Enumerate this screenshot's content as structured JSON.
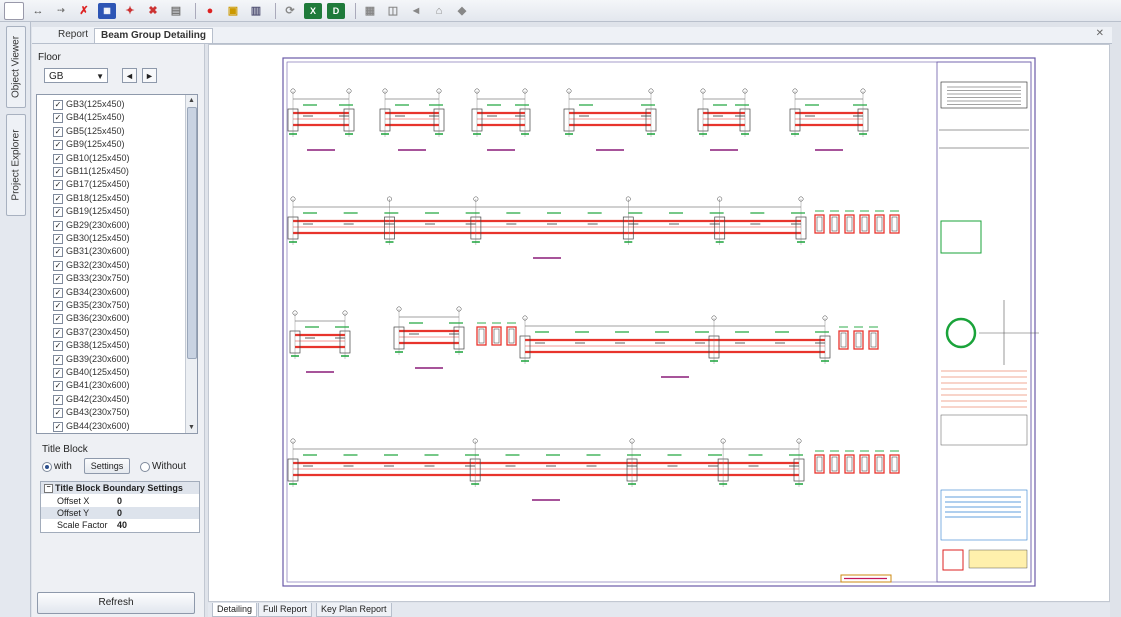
{
  "side_tabs": [
    "Object Viewer",
    "Project Explorer"
  ],
  "doc_tabs": [
    "Report",
    "Beam Group Detailing"
  ],
  "floor": {
    "label": "Floor",
    "value": "GB",
    "nav_prev": "◄",
    "nav_next": "►"
  },
  "beams": [
    {
      "name": "GB3(125x450)",
      "checked": true
    },
    {
      "name": "GB4(125x450)",
      "checked": true
    },
    {
      "name": "GB5(125x450)",
      "checked": true
    },
    {
      "name": "GB9(125x450)",
      "checked": true
    },
    {
      "name": "GB10(125x450)",
      "checked": true
    },
    {
      "name": "GB11(125x450)",
      "checked": true
    },
    {
      "name": "GB17(125x450)",
      "checked": true
    },
    {
      "name": "GB18(125x450)",
      "checked": true
    },
    {
      "name": "GB19(125x450)",
      "checked": true
    },
    {
      "name": "GB29(230x600)",
      "checked": true
    },
    {
      "name": "GB30(125x450)",
      "checked": true
    },
    {
      "name": "GB31(230x600)",
      "checked": true
    },
    {
      "name": "GB32(230x450)",
      "checked": true
    },
    {
      "name": "GB33(230x750)",
      "checked": true
    },
    {
      "name": "GB34(230x600)",
      "checked": true
    },
    {
      "name": "GB35(230x750)",
      "checked": true
    },
    {
      "name": "GB36(230x600)",
      "checked": true
    },
    {
      "name": "GB37(230x450)",
      "checked": true
    },
    {
      "name": "GB38(125x450)",
      "checked": true
    },
    {
      "name": "GB39(230x600)",
      "checked": true
    },
    {
      "name": "GB40(125x450)",
      "checked": true
    },
    {
      "name": "GB41(230x600)",
      "checked": true
    },
    {
      "name": "GB42(230x450)",
      "checked": true
    },
    {
      "name": "GB43(230x750)",
      "checked": true
    },
    {
      "name": "GB44(230x600)",
      "checked": true
    }
  ],
  "title_block": {
    "label": "Title Block",
    "with_label": "with",
    "settings_label": "Settings",
    "without_label": "Without",
    "selected": "with"
  },
  "boundary": {
    "title": "Title Block Boundary Settings",
    "rows": [
      {
        "key": "Offset X",
        "value": "0"
      },
      {
        "key": "Offset Y",
        "value": "0"
      },
      {
        "key": "Scale Factor",
        "value": "40"
      }
    ]
  },
  "refresh_label": "Refresh",
  "bottom_tabs": [
    "Detailing",
    "Full Report",
    "Key Plan Report"
  ],
  "colors": {
    "beam": "#e8342c",
    "annotation": "#1aa33a",
    "dimension": "#8a1c78",
    "frame": "#6a5aa8"
  },
  "toolbar_icons": [
    "select-icon",
    "pan-icon",
    "measure-icon",
    "design-icon",
    "detail-icon",
    "tools-icon",
    "delete-icon",
    "print-icon",
    "record-icon",
    "lock-icon",
    "save-icon",
    "refresh-icon",
    "export-excel-icon",
    "export-dwg-icon",
    "grid-icon",
    "view-icon",
    "back-icon",
    "home-icon",
    "settings-icon"
  ]
}
